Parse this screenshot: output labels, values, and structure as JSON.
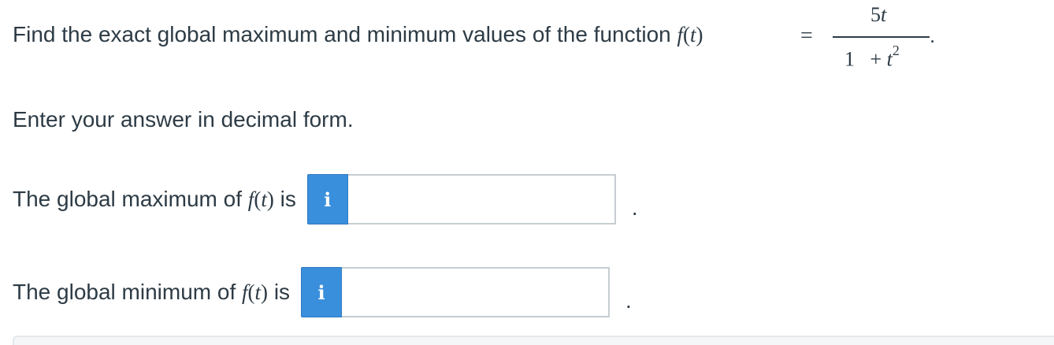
{
  "question": {
    "text": "Find the exact global maximum and minimum values of the function ",
    "func_name": "f",
    "func_var": "t",
    "equals": "=",
    "numerator_coef": "5",
    "numerator_var": "t",
    "denominator_one": "1",
    "denominator_plus": "+",
    "denominator_var": "t",
    "denominator_exp": "2",
    "trailing_period": "."
  },
  "instruction": "Enter your answer in decimal form.",
  "answers": [
    {
      "label_prefix": "The global maximum of ",
      "label_suffix": " is",
      "info_icon": "i",
      "value": "",
      "trailing": "."
    },
    {
      "label_prefix": "The global minimum of ",
      "label_suffix": " is",
      "info_icon": "i",
      "value": "",
      "trailing": "."
    }
  ],
  "colors": {
    "text": "#2d3b45",
    "info_button": "#3a8fdc",
    "input_border": "#c7cdd1"
  }
}
